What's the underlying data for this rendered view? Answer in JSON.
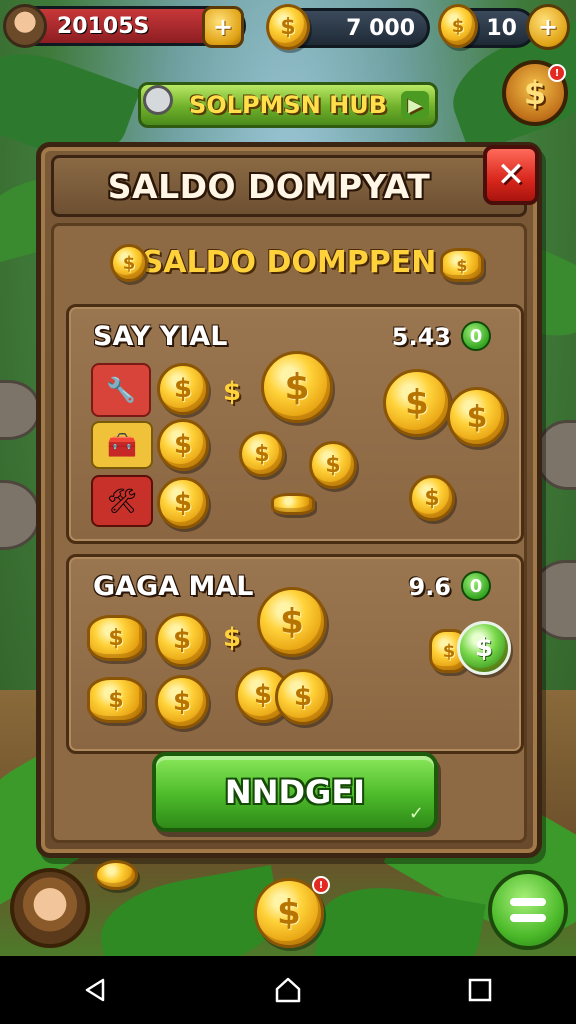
{
  "hud": {
    "player_value": "20105S",
    "coin_value": "7 000",
    "gem_value": "10"
  },
  "hub": {
    "label": "SOLPMSN HUB"
  },
  "panel": {
    "title": "SALDO DOMPYAT",
    "close_label": "✕",
    "subheader": "SALDO DOMPPEN"
  },
  "cards": [
    {
      "title": "SAY YIAL",
      "value": "5.43",
      "badge": "0"
    },
    {
      "title": "GAGA MAL",
      "value": "9.6",
      "badge": "0"
    }
  ],
  "confirm": {
    "label": "NNDGEI",
    "check": "✓"
  },
  "icons": {
    "coin_glyph": "$",
    "plus_glyph": "+",
    "notif": "!"
  },
  "colors": {
    "gold": "#ffd13a",
    "panel_brown": "#7b5a38",
    "button_green": "#4cba2a",
    "close_red": "#d8261c"
  }
}
